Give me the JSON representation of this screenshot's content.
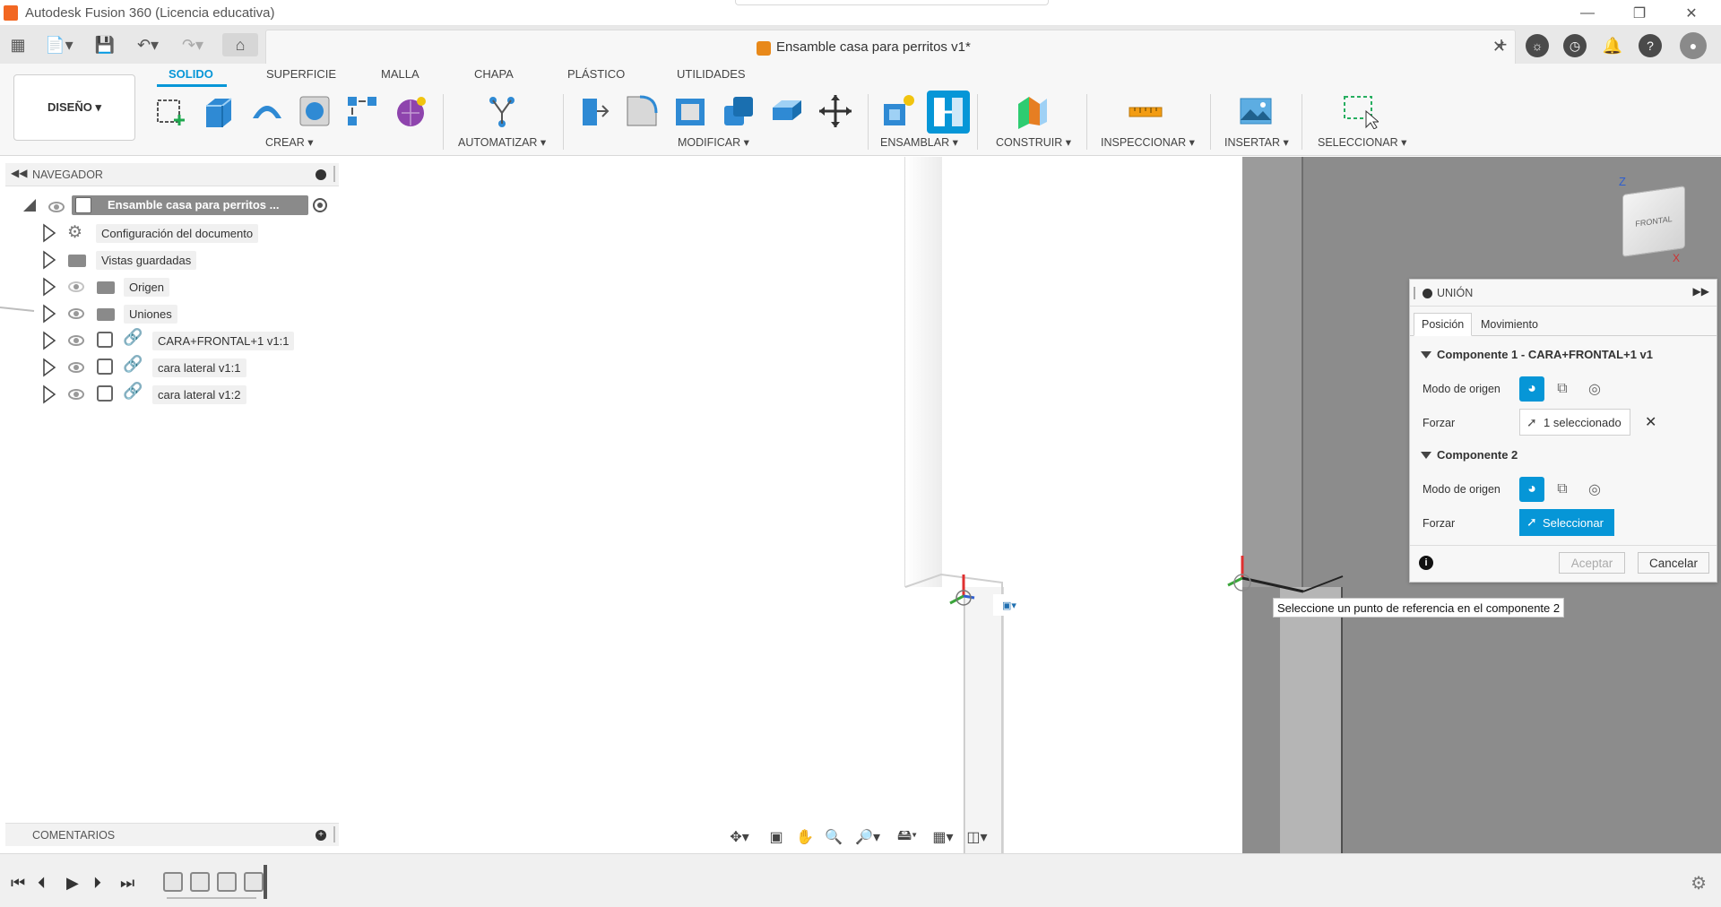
{
  "window": {
    "title": "Autodesk Fusion 360 (Licencia educativa)",
    "minimize_icon": "minimize-icon",
    "restore_icon": "restore-icon",
    "close_icon": "close-icon"
  },
  "document": {
    "title": "Ensamble casa para perritos v1*",
    "close_glyph": "✕"
  },
  "ribbon": {
    "workspace": "DISEÑO ▾",
    "tabs": [
      "SOLIDO",
      "SUPERFICIE",
      "MALLA",
      "CHAPA",
      "PLÁSTICO",
      "UTILIDADES"
    ],
    "active_tab": "SOLIDO",
    "groups": {
      "crear": "CREAR ▾",
      "automatizar": "AUTOMATIZAR ▾",
      "modificar": "MODIFICAR ▾",
      "ensamblar": "ENSAMBLAR ▾",
      "construir": "CONSTRUIR ▾",
      "inspeccionar": "INSPECCIONAR ▾",
      "insertar": "INSERTAR ▾",
      "seleccionar": "SELECCIONAR ▾"
    },
    "accent": "#0696d7"
  },
  "browser": {
    "title": "NAVEGADOR",
    "root": "Ensamble casa para perritos ...",
    "items": [
      {
        "label": "Configuración del documento",
        "icon": "gear-icon"
      },
      {
        "label": "Vistas guardadas",
        "icon": "folder-icon"
      },
      {
        "label": "Origen",
        "icon": "folder-icon"
      },
      {
        "label": "Uniones",
        "icon": "folder-icon"
      },
      {
        "label": "CARA+FRONTAL+1 v1:1",
        "icon": "component-icon"
      },
      {
        "label": "cara lateral v1:1",
        "icon": "component-icon"
      },
      {
        "label": "cara lateral v1:2",
        "icon": "component-icon"
      }
    ]
  },
  "comments": {
    "title": "COMENTARIOS"
  },
  "joint_dialog": {
    "title": "UNIÓN",
    "tabs": [
      "Posición",
      "Movimiento"
    ],
    "active_tab": "Posición",
    "component1": {
      "title": "Componente 1 - CARA+FRONTAL+1 v1",
      "origin_label": "Modo de origen",
      "snap_label": "Forzar",
      "snap_value": "1 seleccionado"
    },
    "component2": {
      "title": "Componente 2",
      "origin_label": "Modo de origen",
      "snap_label": "Forzar",
      "snap_value": "Seleccionar"
    },
    "ok": "Aceptar",
    "cancel": "Cancelar"
  },
  "tooltip": "Seleccione un punto de referencia en el componente 2",
  "viewcube": {
    "face": "FRONTAL",
    "axis_z": "Z",
    "axis_x": "X"
  }
}
